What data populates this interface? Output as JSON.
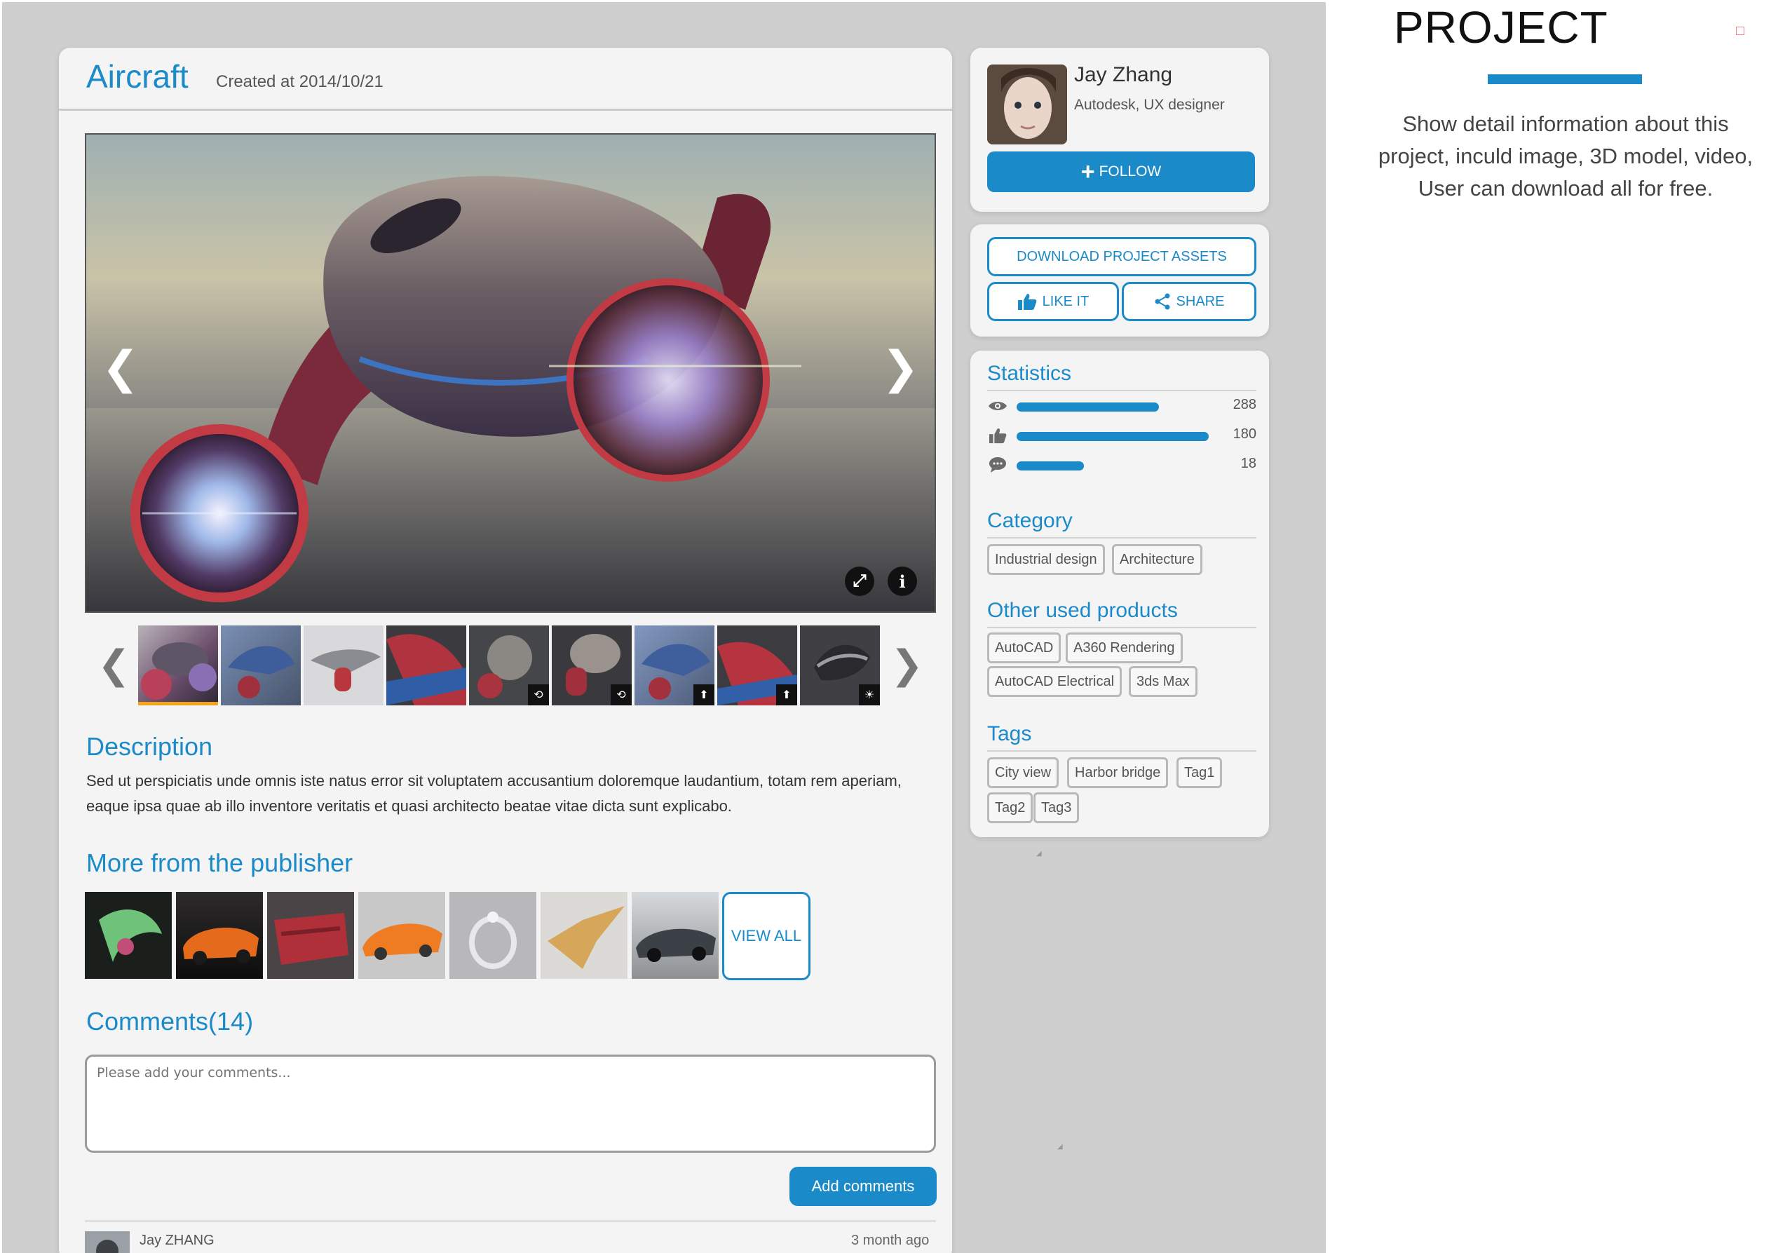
{
  "project": {
    "title": "Aircraft",
    "created_at": "Created at 2014/10/21"
  },
  "hero": {
    "prev_icon": "chevron-left-icon",
    "next_icon": "chevron-right-icon",
    "prev_glyph": "❮",
    "next_glyph": "❯",
    "expand_glyph": "⤢",
    "info_glyph": "i"
  },
  "thumbnails": {
    "prev_glyph": "❮",
    "next_glyph": "❯",
    "badges": [
      "",
      "",
      "",
      "",
      "⟲",
      "⟲",
      "⬆",
      "⬆",
      "☀"
    ]
  },
  "description": {
    "title": "Description",
    "text": "Sed ut perspiciatis unde omnis iste natus error sit voluptatem accusantium doloremque laudantium, totam rem aperiam, eaque ipsa quae ab illo inventore veritatis et quasi architecto beatae vitae dicta sunt explicabo."
  },
  "more": {
    "title": "More from the publisher",
    "view_all": "VIEW ALL"
  },
  "comments": {
    "title": "Comments(14)",
    "placeholder": "Please add your comments...",
    "add_label": "Add comments",
    "items": [
      {
        "author": "Jay ZHANG",
        "time": "3 month ago"
      }
    ]
  },
  "profile": {
    "name": "Jay Zhang",
    "role": "Autodesk, UX designer",
    "follow_label": "FOLLOW"
  },
  "actions": {
    "download_label": "DOWNLOAD PROJECT ASSETS",
    "like_label": "LIKE IT",
    "share_label": "SHARE"
  },
  "statistics": {
    "title": "Statistics",
    "rows": [
      {
        "icon": "eye-icon",
        "value": "288",
        "fill": 0.74
      },
      {
        "icon": "thumbs-up-icon",
        "value": "180",
        "fill": 1.0
      },
      {
        "icon": "comment-icon",
        "value": "18",
        "fill": 0.35
      }
    ]
  },
  "category": {
    "title": "Category",
    "tags": [
      "Industrial design",
      "Architecture"
    ]
  },
  "products": {
    "title": "Other used products",
    "tags": [
      "AutoCAD",
      "A360 Rendering",
      "AutoCAD Electrical",
      "3ds Max"
    ]
  },
  "tags": {
    "title": "Tags",
    "tags": [
      "City view",
      "Harbor bridge",
      "Tag1",
      "Tag2",
      "Tag3"
    ]
  },
  "annotation": {
    "title": "PROJECT",
    "text": "Show detail information about this project, inculd image, 3D model, video, User can download all for free."
  },
  "colors": {
    "accent": "#1b8ac9",
    "canvas": "#cfcfcf",
    "card": "#f4f4f4",
    "active_thumb": "#f2a41b"
  }
}
